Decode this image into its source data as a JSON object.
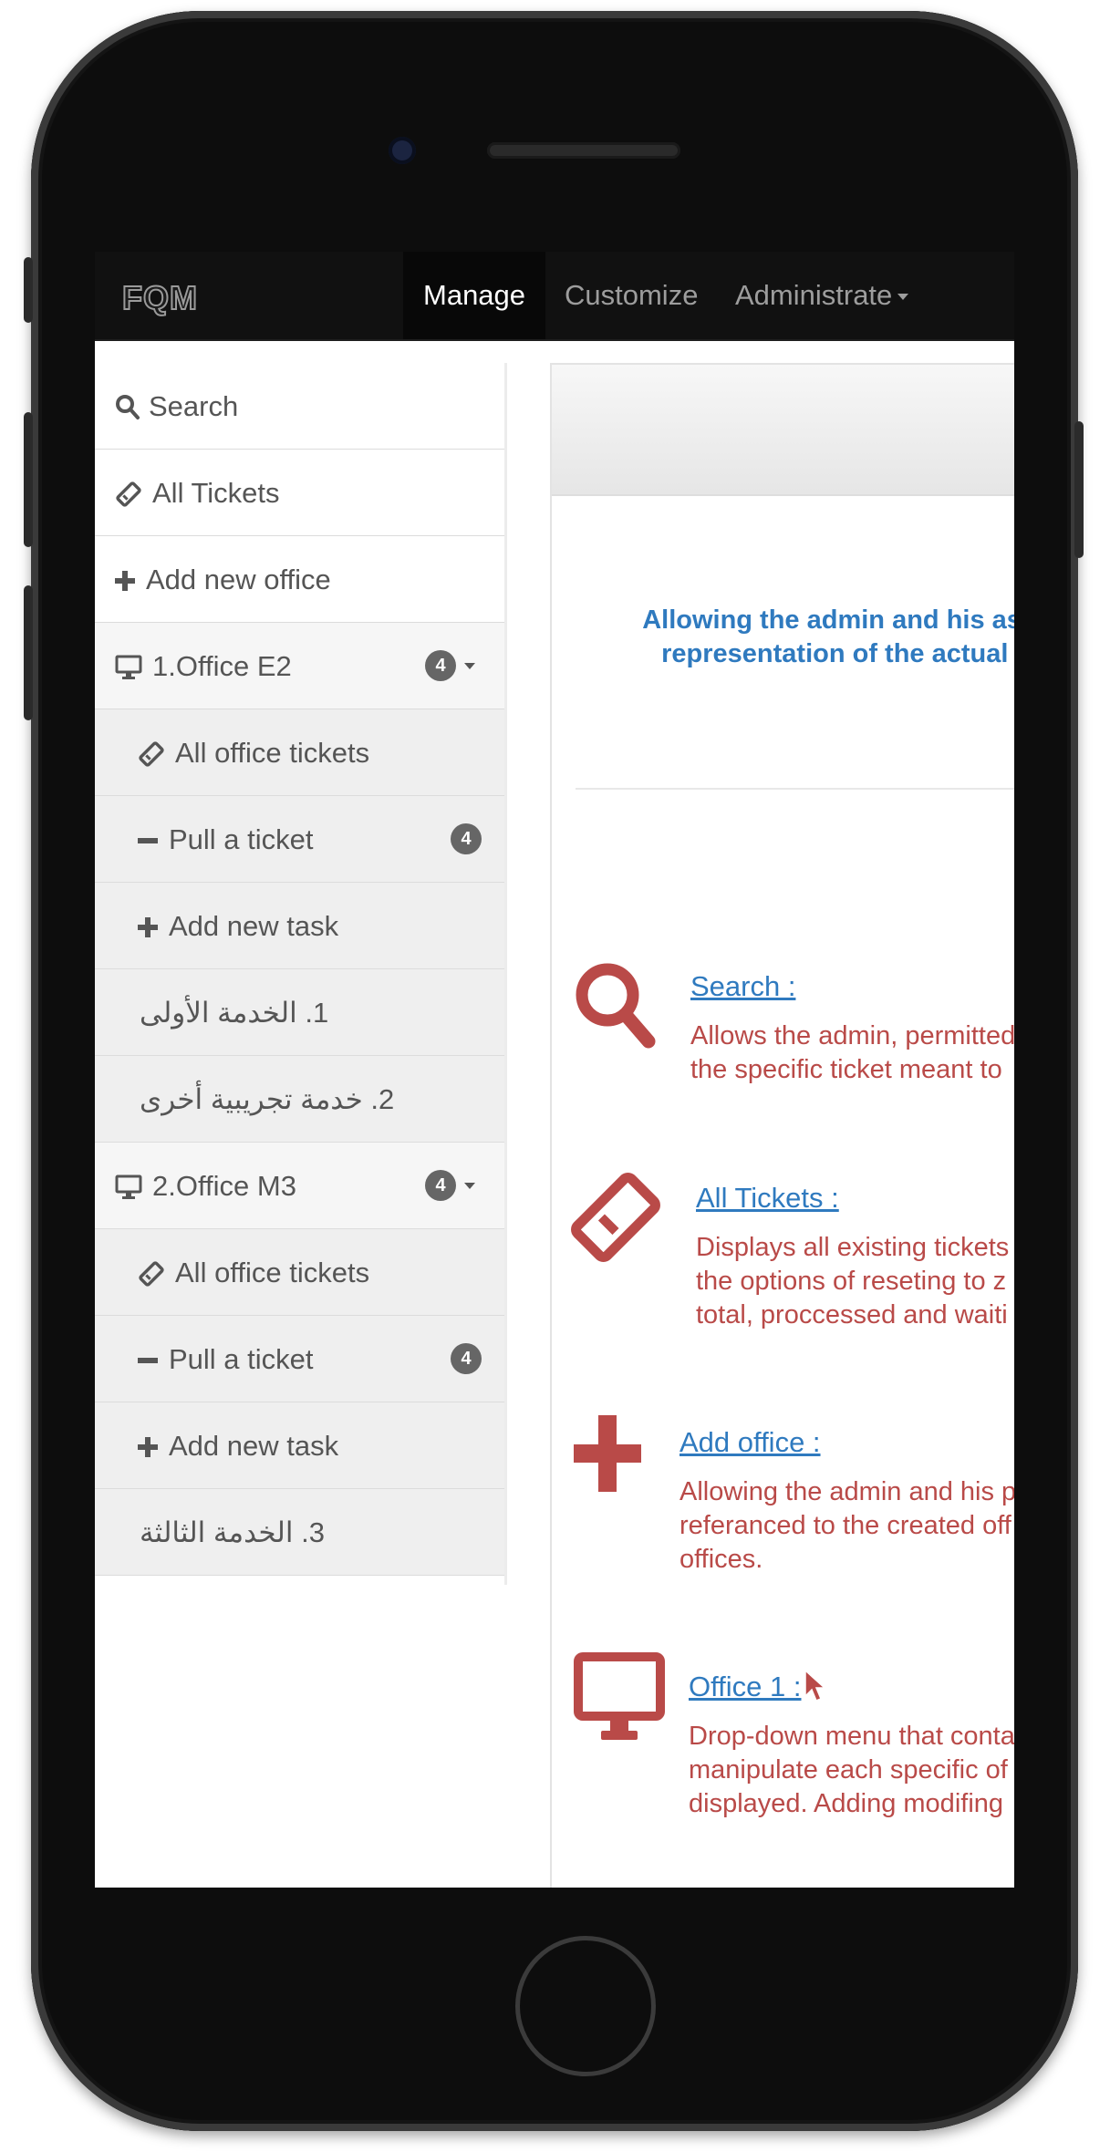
{
  "navbar": {
    "brand": "FQM",
    "items": [
      {
        "label": "Manage",
        "active": true
      },
      {
        "label": "Customize"
      },
      {
        "label": "Administrate"
      }
    ]
  },
  "sidebar": {
    "search": "Search",
    "all_tickets": "All Tickets",
    "add_office": "Add new office",
    "offices": [
      {
        "label": "1.Office E2",
        "badge": "4",
        "items": {
          "all_office_tickets": "All office tickets",
          "pull_ticket": "Pull a ticket",
          "pull_badge": "4",
          "add_task": "Add new task",
          "tasks": [
            "1. الخدمة الأولى",
            "2. خدمة تجريبية أخرى"
          ]
        }
      },
      {
        "label": "2.Office M3",
        "badge": "4",
        "items": {
          "all_office_tickets": "All office tickets",
          "pull_ticket": "Pull a ticket",
          "pull_badge": "4",
          "add_task": "Add new task",
          "tasks": [
            "3. الخدمة الثالثة"
          ]
        }
      }
    ]
  },
  "main": {
    "intro": [
      "Allowing the admin and his assig",
      "representation of the actual of"
    ],
    "features": [
      {
        "icon": "search-icon",
        "title": "Search :",
        "desc": [
          "Allows the admin, permitted",
          "the specific ticket meant to"
        ]
      },
      {
        "icon": "ticket-icon",
        "title": "All Tickets :",
        "desc": [
          "Displays all existing tickets",
          "the options of reseting to z",
          "total, proccessed and waiti"
        ]
      },
      {
        "icon": "plus-icon",
        "title": "Add office :",
        "desc": [
          "Allowing the admin and his p",
          "referanced to the created off",
          "offices."
        ]
      },
      {
        "icon": "monitor-icon",
        "title": "Office 1 :",
        "desc": [
          "Drop-down menu that conta",
          "manipulate each specific of",
          "displayed. Adding modifing"
        ]
      }
    ]
  },
  "colors": {
    "link": "#2f7abf",
    "description": "#b94a48",
    "navbar": "#111111"
  }
}
